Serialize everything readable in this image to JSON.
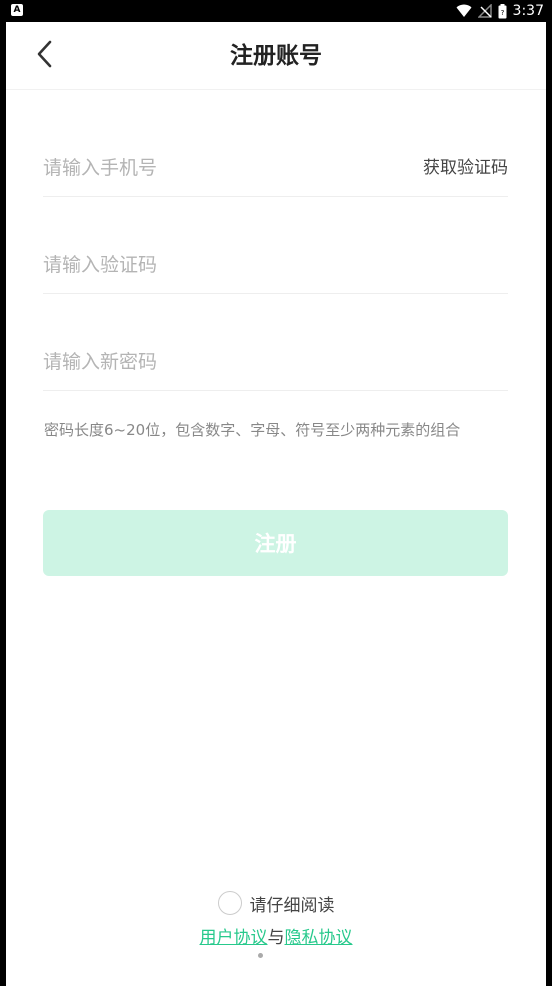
{
  "status_bar": {
    "left_icon_letter": "A",
    "time": "3:37",
    "icons": [
      "wifi-icon",
      "no-signal-icon",
      "battery-icon"
    ]
  },
  "header": {
    "back_icon": "chevron-left-icon",
    "title": "注册账号"
  },
  "form": {
    "phone": {
      "placeholder": "请输入手机号",
      "value": ""
    },
    "get_code_label": "获取验证码",
    "code": {
      "placeholder": "请输入验证码",
      "value": ""
    },
    "password": {
      "placeholder": "请输入新密码",
      "value": ""
    },
    "password_hint": "密码长度6~20位，包含数字、字母、符号至少两种元素的组合",
    "submit_label": "注册"
  },
  "agreement": {
    "prompt": "请仔细阅读",
    "user_agreement": "用户协议",
    "conjunction": "与",
    "privacy_agreement": "隐私协议",
    "checked": false
  },
  "colors": {
    "accent": "#27c98c",
    "button_disabled_bg": "#cdf4e4",
    "placeholder": "#b4b4b4"
  }
}
